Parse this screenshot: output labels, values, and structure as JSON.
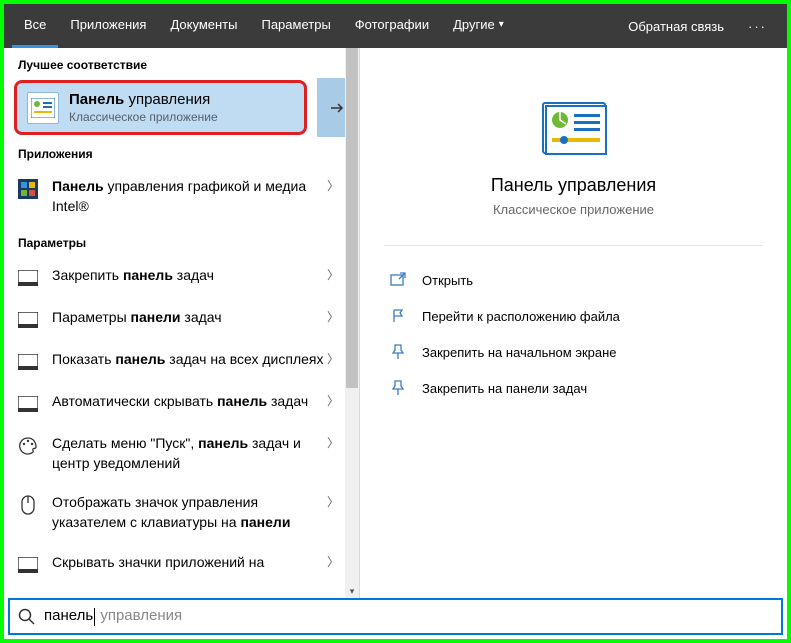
{
  "tabs": {
    "all": "Все",
    "apps": "Приложения",
    "docs": "Документы",
    "settings": "Параметры",
    "photos": "Фотографии",
    "other": "Другие",
    "feedback": "Обратная связь"
  },
  "sections": {
    "best_match": "Лучшее соответствие",
    "apps": "Приложения",
    "settings": "Параметры"
  },
  "best_match": {
    "title_bold": "Панель",
    "title_rest": " управления",
    "subtitle": "Классическое приложение"
  },
  "apps_results": [
    {
      "pre": "",
      "bold": "Панель",
      "rest": " управления графикой и медиа Intel®"
    }
  ],
  "settings_results": [
    {
      "pre": "Закрепить ",
      "bold": "панель",
      "rest": " задач"
    },
    {
      "pre": "Параметры ",
      "bold": "панели",
      "rest": " задач"
    },
    {
      "pre": "Показать ",
      "bold": "панель",
      "rest": " задач на всех дисплеях"
    },
    {
      "pre": "Автоматически скрывать ",
      "bold": "панель",
      "rest": " задач"
    },
    {
      "pre": "Сделать меню \"Пуск\", ",
      "bold": "панель",
      "rest": " задач и центр уведомлений"
    },
    {
      "pre": "Отображать значок управления указателем с клавиатуры на ",
      "bold": "панели",
      "rest": ""
    },
    {
      "pre": "Скрывать значки приложений на",
      "bold": "",
      "rest": ""
    }
  ],
  "preview": {
    "title": "Панель управления",
    "subtitle": "Классическое приложение",
    "actions": {
      "open": "Открыть",
      "open_location": "Перейти к расположению файла",
      "pin_start": "Закрепить на начальном экране",
      "pin_taskbar": "Закрепить на панели задач"
    }
  },
  "search": {
    "typed": "панель",
    "ghost": " управления"
  }
}
